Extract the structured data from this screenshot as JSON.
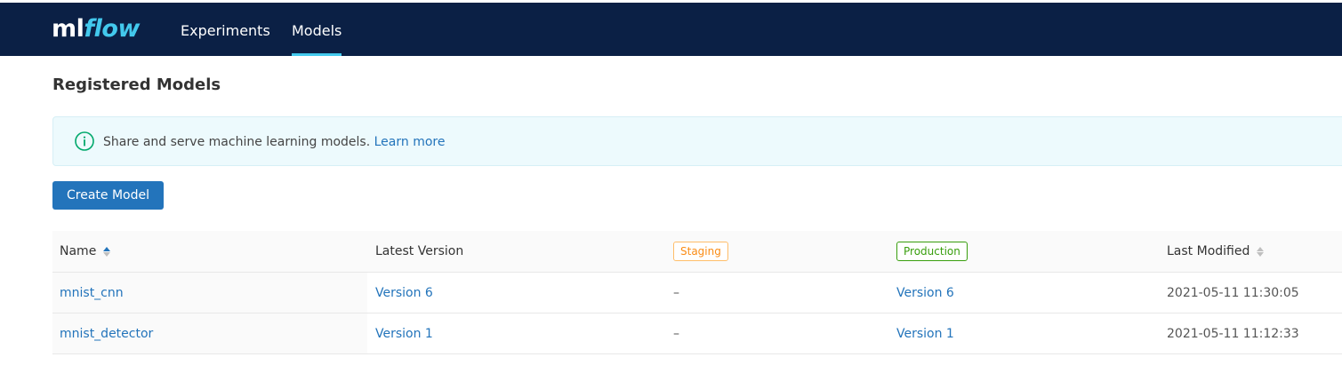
{
  "app": {
    "logo_ml": "ml",
    "logo_flow": "flow"
  },
  "nav": {
    "items": [
      {
        "label": "Experiments",
        "active": false
      },
      {
        "label": "Models",
        "active": true
      }
    ]
  },
  "page": {
    "title": "Registered Models"
  },
  "info_banner": {
    "icon": "info-circle-icon",
    "text": "Share and serve machine learning models.",
    "link_text": "Learn more"
  },
  "actions": {
    "create_model_label": "Create Model"
  },
  "table": {
    "columns": [
      {
        "label": "Name",
        "sortable": true,
        "sort": "ascending"
      },
      {
        "label": "Latest Version",
        "sortable": false
      },
      {
        "label": "Staging",
        "tag": true
      },
      {
        "label": "Production",
        "tag": true
      },
      {
        "label": "Last Modified",
        "sortable": true,
        "sort": "none"
      }
    ],
    "rows": [
      {
        "name": "mnist_cnn",
        "latest_version": "Version 6",
        "staging": "–",
        "production": "Version 6",
        "last_modified": "2021-05-11 11:30:05"
      },
      {
        "name": "mnist_detector",
        "latest_version": "Version 1",
        "staging": "–",
        "production": "Version 1",
        "last_modified": "2021-05-11 11:12:33"
      }
    ]
  },
  "colors": {
    "navbar_bg": "#0b2045",
    "accent": "#43c9ed",
    "link": "#2374bb",
    "button": "#2374bb",
    "staging": "#fa8c16",
    "production": "#389e0d",
    "info_bg": "#edfafd",
    "info_icon": "#00a86b"
  }
}
